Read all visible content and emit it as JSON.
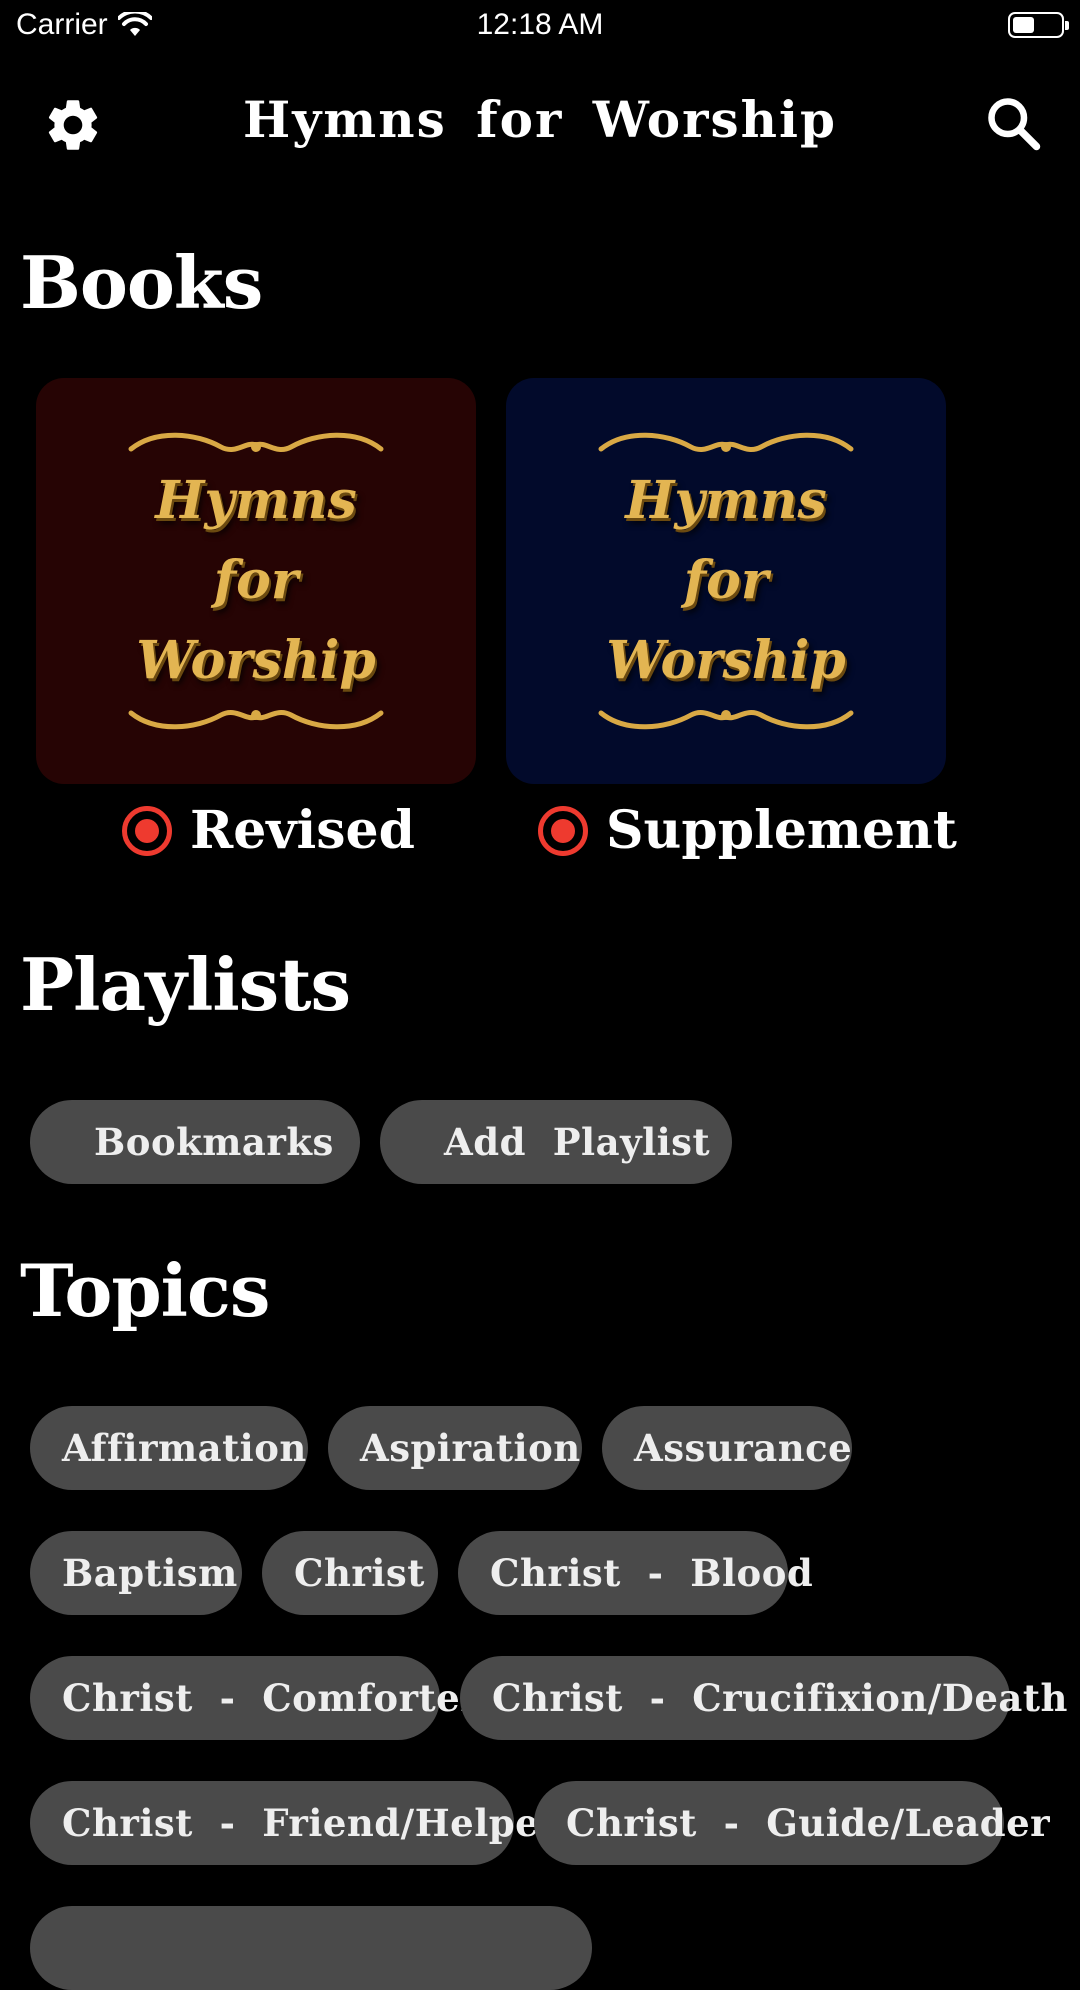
{
  "status_bar": {
    "carrier": "Carrier",
    "time": "12:18 AM",
    "battery_level": 0.45
  },
  "nav": {
    "title": "Hymns  for  Worship",
    "settings_icon": "gear-icon",
    "search_icon": "search-icon"
  },
  "sections": {
    "books": "Books",
    "playlists": "Playlists",
    "topics": "Topics"
  },
  "books": [
    {
      "cover_line1": "Hymns",
      "cover_line2": "for",
      "cover_line3": "Worship",
      "label": "Revised",
      "color": "#260404"
    },
    {
      "cover_line1": "Hymns",
      "cover_line2": "for",
      "cover_line3": "Worship",
      "label": "Supplement",
      "color": "#020a2b"
    }
  ],
  "accent_color": "#ee3a2f",
  "cover_text_color": "#e3b552",
  "playlists": [
    {
      "label": "Bookmarks",
      "icon": "bookmark-icon"
    },
    {
      "label": "Add  Playlist",
      "icon": "plus-icon"
    }
  ],
  "topics": [
    "Affirmation",
    "Aspiration",
    "Assurance",
    "Baptism",
    "Christ",
    "Christ  -  Blood",
    "Christ  -  Comforter",
    "Christ  -  Crucifixion/Death",
    "Christ  -  Friend/Helper",
    "Christ  -  Guide/Leader"
  ]
}
